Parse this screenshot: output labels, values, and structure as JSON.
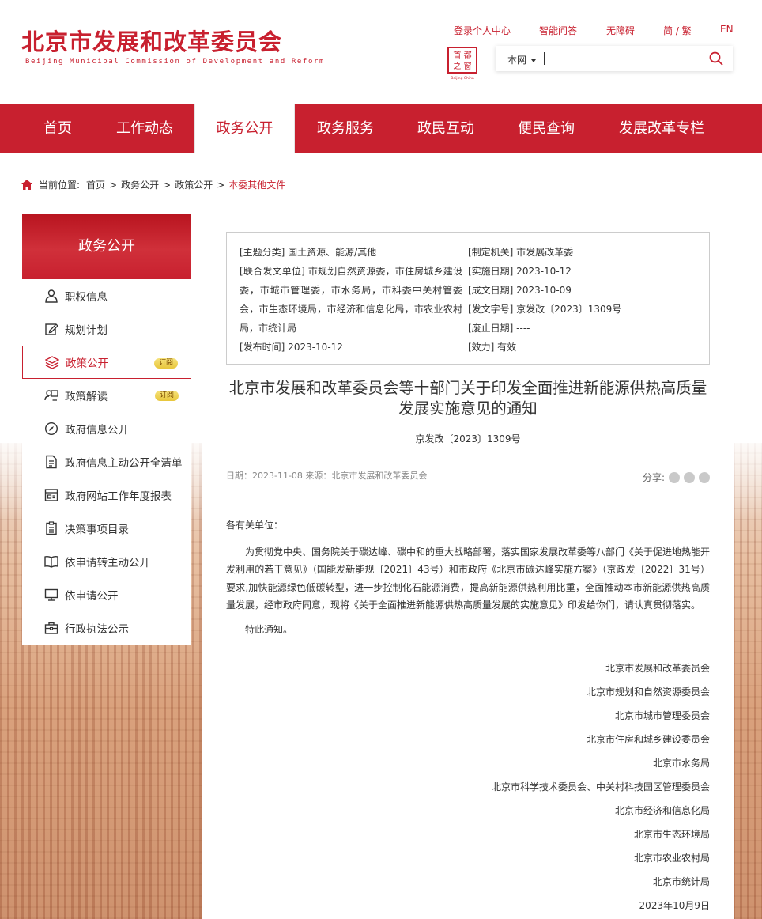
{
  "header": {
    "logo_cn": "北京市发展和改革委员会",
    "logo_en": "Beijing Municipal Commission of Development and Reform",
    "links": [
      "登录个人中心",
      "智能问答",
      "无障碍",
      "简 / 繁",
      "EN"
    ],
    "seal_text": "Beijing·China",
    "search_scope": "本网",
    "search_placeholder": ""
  },
  "nav": {
    "items": [
      "首页",
      "工作动态",
      "政务公开",
      "政务服务",
      "政民互动",
      "便民查询",
      "发展改革专栏"
    ],
    "active": "政务公开"
  },
  "breadcrumb": {
    "label": "当前位置:",
    "items": [
      "首页",
      "政务公开",
      "政策公开"
    ],
    "current": "本委其他文件",
    "sep": ">"
  },
  "sidebar": {
    "title": "政务公开",
    "items": [
      {
        "label": "职权信息",
        "icon": "person-icon"
      },
      {
        "label": "规划计划",
        "icon": "edit-icon"
      },
      {
        "label": "政策公开",
        "icon": "layers-icon",
        "badge": "订阅"
      },
      {
        "label": "政策解读",
        "icon": "interpret-icon",
        "badge": "订阅"
      },
      {
        "label": "政府信息公开",
        "icon": "compass-icon"
      },
      {
        "label": "政府信息主动公开全清单",
        "icon": "document-icon"
      },
      {
        "label": "政府网站工作年度报表",
        "icon": "report-icon"
      },
      {
        "label": "决策事项目录",
        "icon": "list-icon"
      },
      {
        "label": "依申请转主动公开",
        "icon": "book-icon"
      },
      {
        "label": "依申请公开",
        "icon": "monitor-icon"
      },
      {
        "label": "行政执法公示",
        "icon": "briefcase-icon"
      }
    ],
    "active_index": 2
  },
  "meta": {
    "left": [
      "[主题分类] 国土资源、能源/其他",
      "[联合发文单位] 市规划自然资源委，市住房城乡建设委，市城市管理委，市水务局，市科委中关村管委会，市生态环境局，市经济和信息化局，市农业农村局，市统计局",
      "[发布时间] 2023-10-12"
    ],
    "right": [
      "[制定机关] 市发展改革委",
      "[实施日期] 2023-10-12",
      "[成文日期] 2023-10-09",
      "[发文字号] 京发改〔2023〕1309号",
      "[废止日期] ----",
      "[效力] 有效"
    ]
  },
  "article": {
    "title": "北京市发展和改革委员会等十部门关于印发全面推进新能源供热高质量发展实施意见的通知",
    "doc_no": "京发改〔2023〕1309号",
    "date_line": "日期：2023-11-08   来源：北京市发展和改革委员会",
    "share_label": "分享:",
    "salutation": "各有关单位：",
    "paragraph": "为贯彻党中央、国务院关于碳达峰、碳中和的重大战略部署，落实国家发展改革委等八部门《关于促进地热能开发利用的若干意见》（国能发新能规〔2021〕43号）和市政府《北京市碳达峰实施方案》（京政发〔2022〕31号）要求,加快能源绿色低碳转型，进一步控制化石能源消费，提高新能源供热利用比重，全面推动本市新能源供热高质量发展，经市政府同意，现将《关于全面推进新能源供热高质量发展的实施意见》印发给你们，请认真贯彻落实。",
    "closing": "特此通知。",
    "signatures": [
      "北京市发展和改革委员会",
      "北京市规划和自然资源委员会",
      "北京市城市管理委员会",
      "北京市住房和城乡建设委员会",
      "北京市水务局",
      "北京市科学技术委员会、中关村科技园区管理委员会",
      "北京市经济和信息化局",
      "北京市生态环境局",
      "北京市农业农村局",
      "北京市统计局",
      "2023年10月9日"
    ]
  },
  "colors": {
    "brand_red": "#c8202f",
    "badge_gold": "#e8c63c"
  }
}
